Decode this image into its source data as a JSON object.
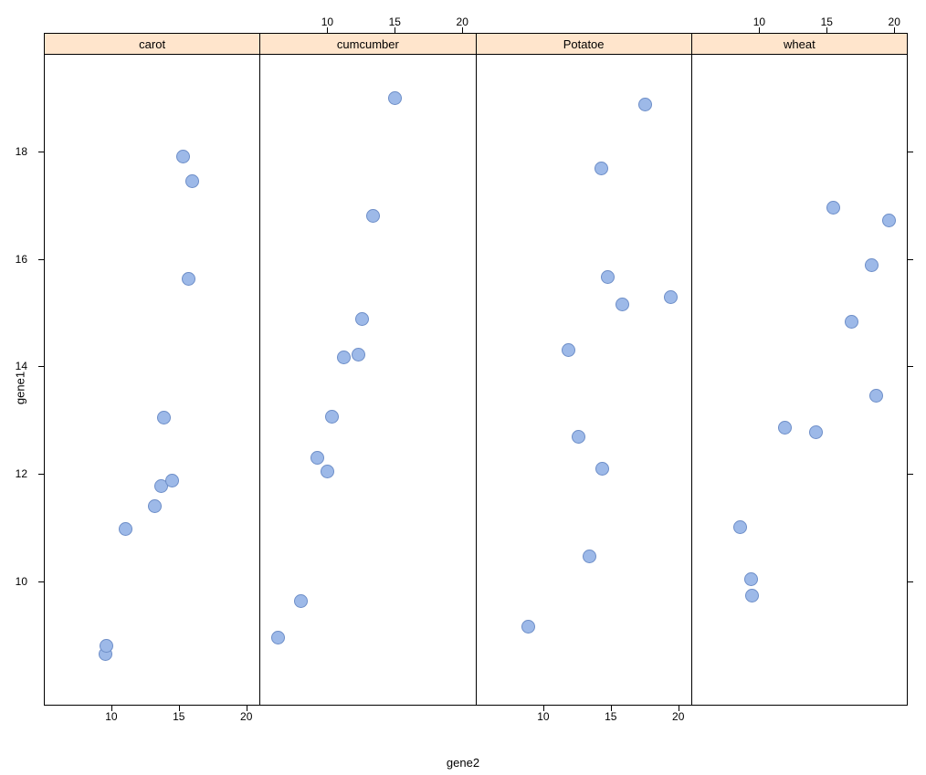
{
  "chart_data": {
    "type": "scatter",
    "xlabel": "gene2",
    "ylabel": "gene1",
    "xlim": [
      5,
      21
    ],
    "ylim": [
      7.7,
      19.8
    ],
    "xticks": [
      10,
      15,
      20
    ],
    "yticks": [
      10,
      12,
      14,
      16,
      18
    ],
    "panel_axis_top": [
      false,
      true,
      false,
      true
    ],
    "panel_axis_bottom": [
      true,
      false,
      true,
      false
    ],
    "panel_ytick_left": true,
    "panel_ytick_right": true,
    "panels": [
      {
        "label": "carot",
        "points": [
          {
            "x": 9.5,
            "y": 8.65
          },
          {
            "x": 9.6,
            "y": 8.8
          },
          {
            "x": 11.0,
            "y": 10.97
          },
          {
            "x": 13.2,
            "y": 11.4
          },
          {
            "x": 13.7,
            "y": 11.77
          },
          {
            "x": 14.5,
            "y": 11.88
          },
          {
            "x": 13.9,
            "y": 13.05
          },
          {
            "x": 15.7,
            "y": 15.62
          },
          {
            "x": 16.0,
            "y": 17.45
          },
          {
            "x": 15.3,
            "y": 17.9
          }
        ]
      },
      {
        "label": "cumcumber",
        "points": [
          {
            "x": 6.3,
            "y": 8.95
          },
          {
            "x": 8.0,
            "y": 9.63
          },
          {
            "x": 9.2,
            "y": 12.3
          },
          {
            "x": 10.0,
            "y": 12.05
          },
          {
            "x": 10.3,
            "y": 13.07
          },
          {
            "x": 11.2,
            "y": 14.17
          },
          {
            "x": 12.3,
            "y": 14.22
          },
          {
            "x": 12.6,
            "y": 14.88
          },
          {
            "x": 13.4,
            "y": 16.8
          },
          {
            "x": 15.0,
            "y": 19.0
          }
        ]
      },
      {
        "label": "Potatoe",
        "points": [
          {
            "x": 8.9,
            "y": 9.15
          },
          {
            "x": 13.4,
            "y": 10.47
          },
          {
            "x": 14.4,
            "y": 12.1
          },
          {
            "x": 12.6,
            "y": 12.68
          },
          {
            "x": 11.9,
            "y": 14.3
          },
          {
            "x": 15.9,
            "y": 15.15
          },
          {
            "x": 19.5,
            "y": 15.28
          },
          {
            "x": 14.8,
            "y": 15.67
          },
          {
            "x": 14.3,
            "y": 17.68
          },
          {
            "x": 17.6,
            "y": 18.87
          }
        ]
      },
      {
        "label": "wheat",
        "points": [
          {
            "x": 9.5,
            "y": 9.73
          },
          {
            "x": 9.4,
            "y": 10.04
          },
          {
            "x": 8.6,
            "y": 11.0
          },
          {
            "x": 14.2,
            "y": 12.78
          },
          {
            "x": 11.9,
            "y": 12.85
          },
          {
            "x": 18.7,
            "y": 13.46
          },
          {
            "x": 16.9,
            "y": 14.83
          },
          {
            "x": 18.4,
            "y": 15.88
          },
          {
            "x": 19.7,
            "y": 16.71
          },
          {
            "x": 15.5,
            "y": 16.96
          }
        ]
      }
    ]
  }
}
